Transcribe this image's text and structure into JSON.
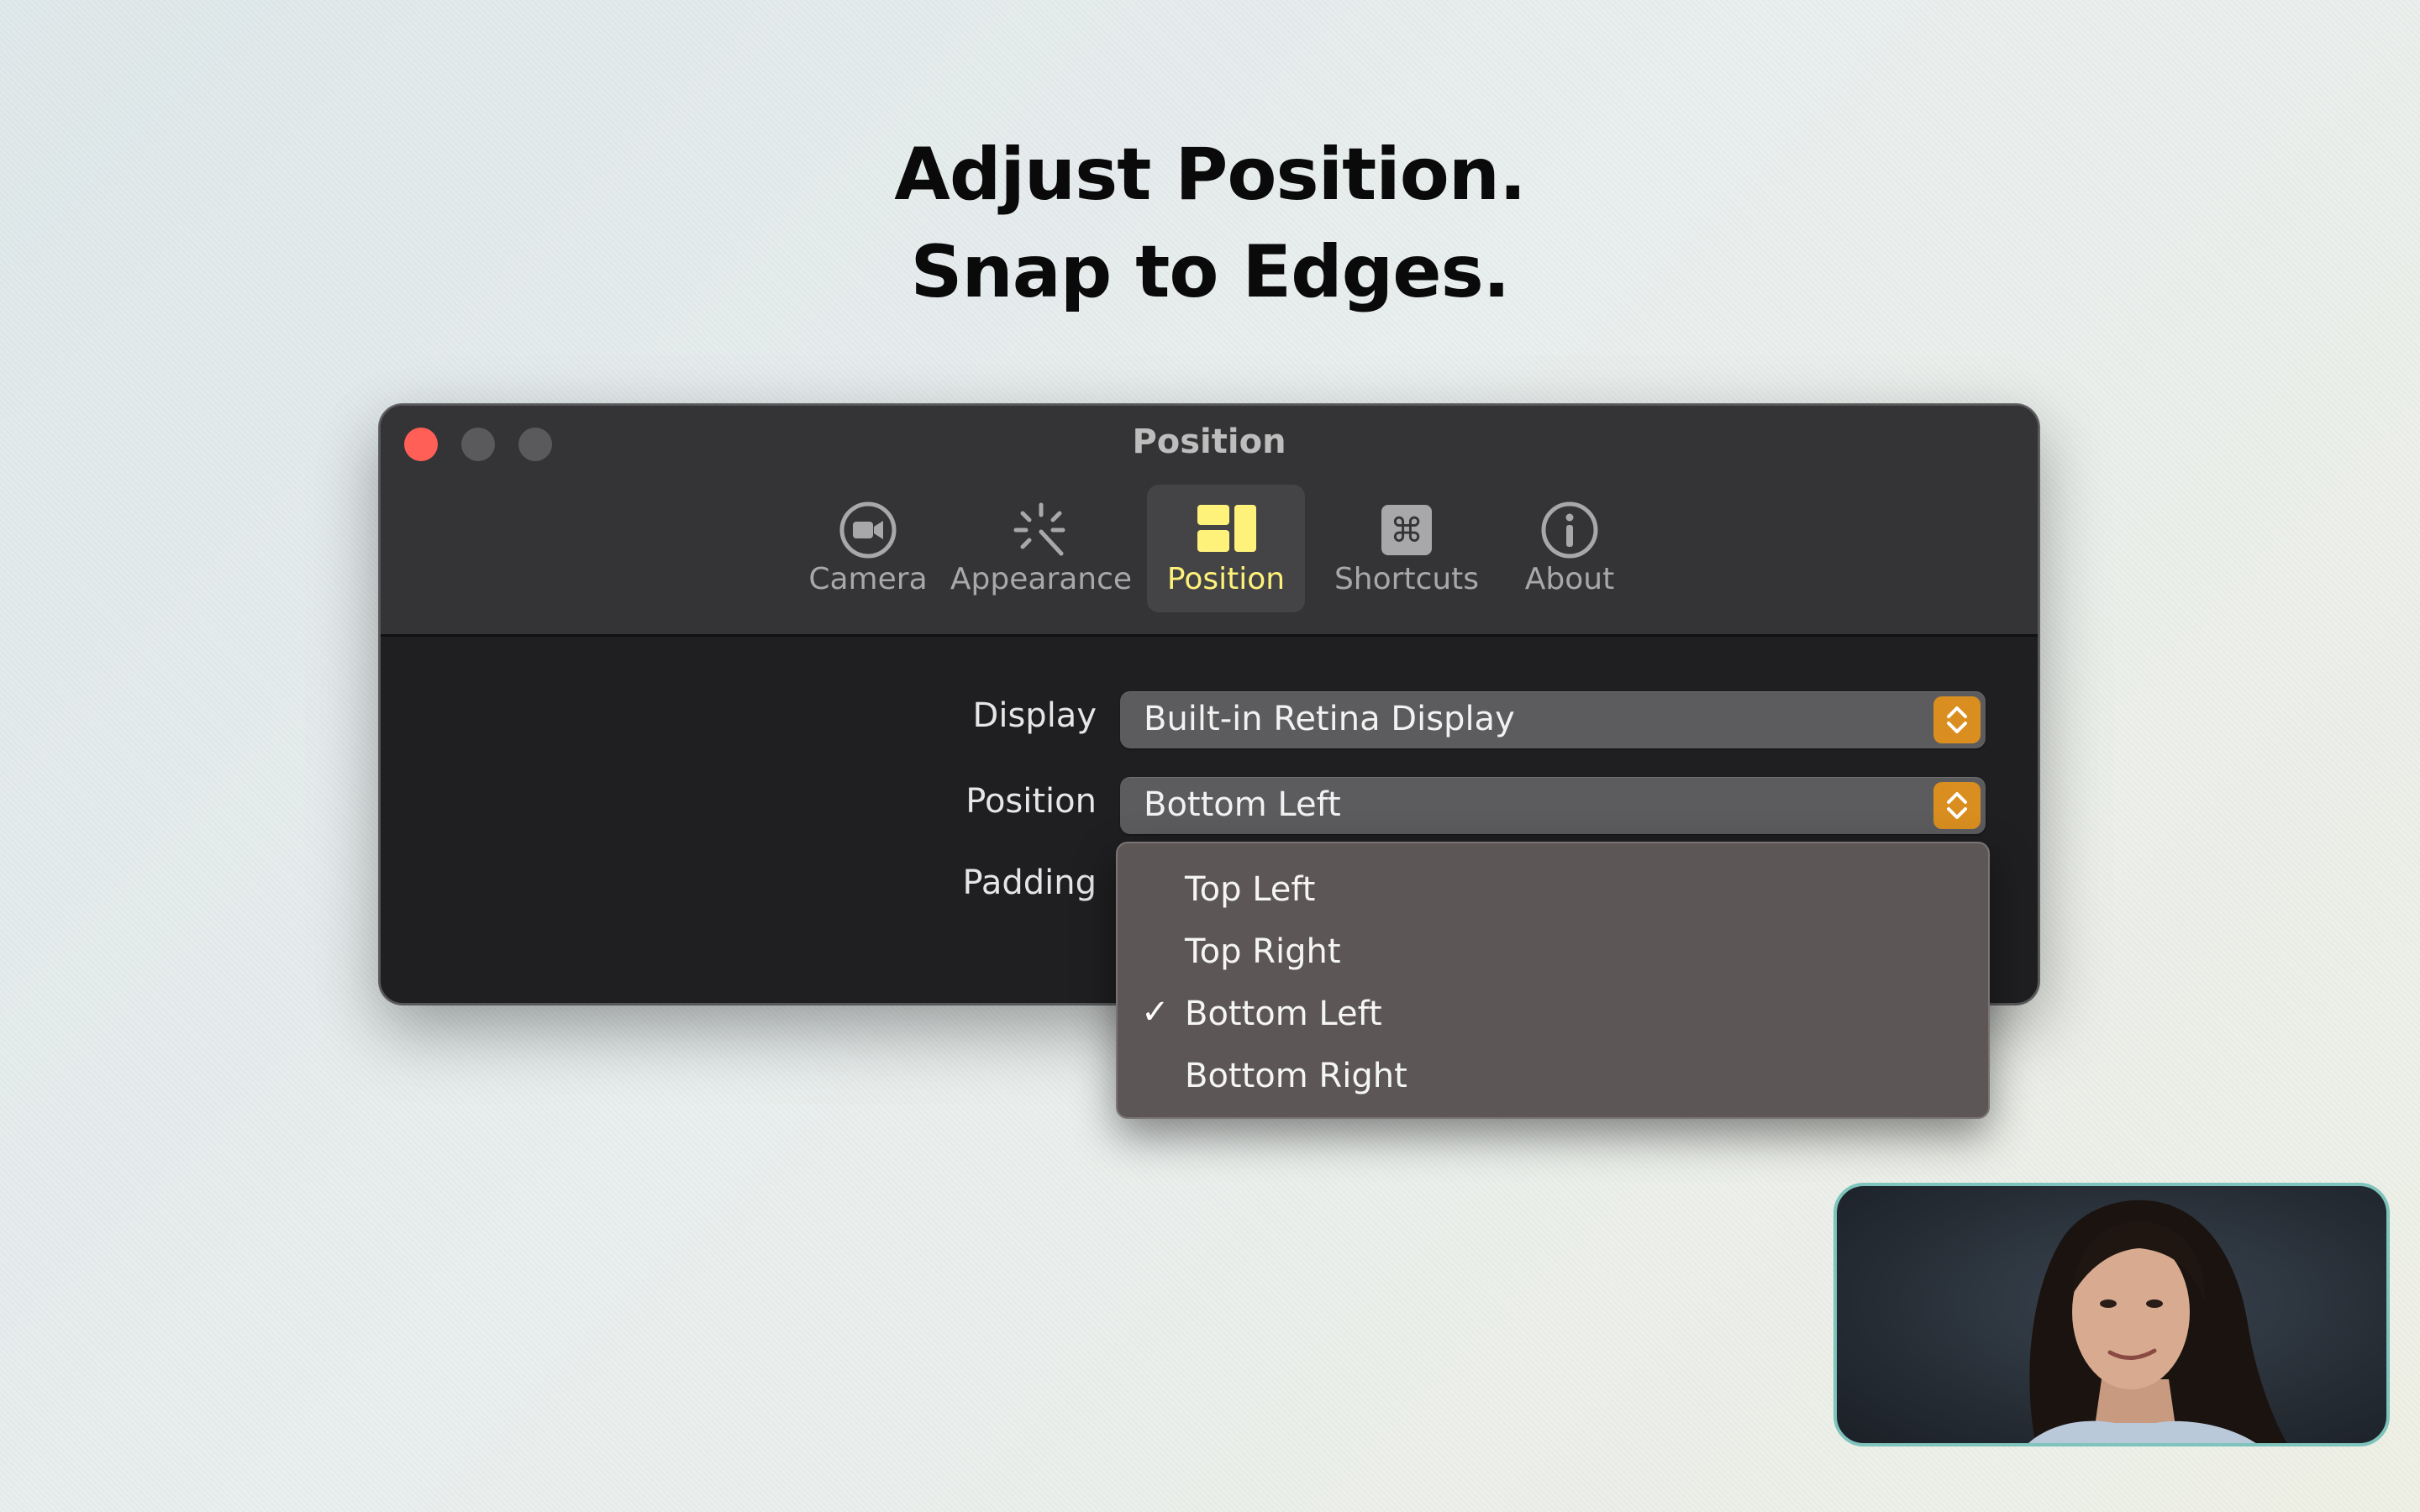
{
  "headline": {
    "line1": "Adjust Position.",
    "line2": "Snap to Edges."
  },
  "window": {
    "title": "Position",
    "toolbar": [
      {
        "label": "Camera",
        "icon": "camera-icon",
        "active": false
      },
      {
        "label": "Appearance",
        "icon": "magic-wand-icon",
        "active": false
      },
      {
        "label": "Position",
        "icon": "position-layout-icon",
        "active": true
      },
      {
        "label": "Shortcuts",
        "icon": "command-key-icon",
        "active": false
      },
      {
        "label": "About",
        "icon": "info-icon",
        "active": false
      }
    ],
    "form": {
      "display_label": "Display",
      "display_value": "Built-in Retina Display",
      "position_label": "Position",
      "position_value": "Bottom Left",
      "padding_label": "Padding"
    }
  },
  "dropdown": {
    "items": [
      {
        "label": "Top Left",
        "checked": false
      },
      {
        "label": "Top Right",
        "checked": false
      },
      {
        "label": "Bottom Left",
        "checked": true
      },
      {
        "label": "Bottom Right",
        "checked": false
      }
    ],
    "check_glyph": "✓"
  },
  "colors": {
    "accent_active": "#fff27a",
    "stepper": "#d98e1f",
    "close": "#ff5f57",
    "pip_border": "#7fc3bd"
  }
}
